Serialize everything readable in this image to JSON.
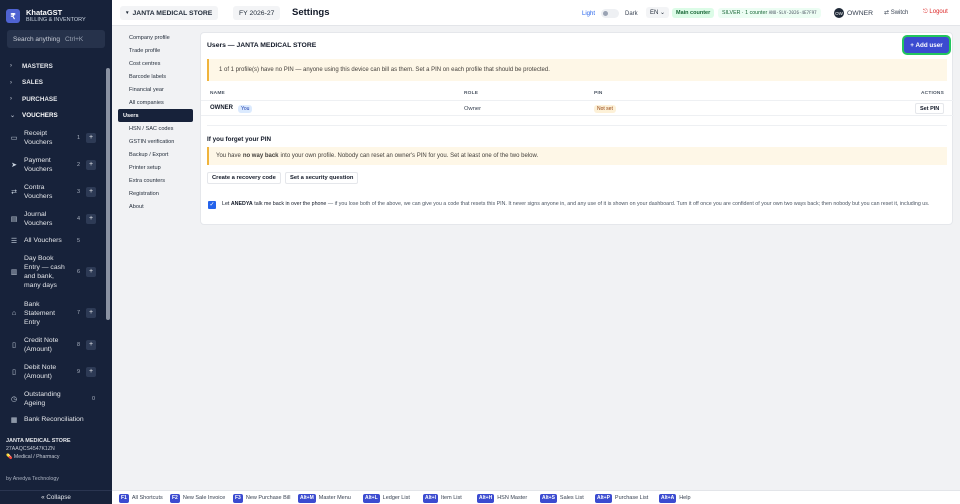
{
  "brand": {
    "name": "KhataGST",
    "subtitle": "BILLING & INVENTORY",
    "logo": "₹"
  },
  "sidebar": {
    "search_placeholder": "Search anything",
    "search_kbd": "Ctrl+K",
    "groups": [
      {
        "label": "MASTERS"
      },
      {
        "label": "SALES"
      },
      {
        "label": "PURCHASE"
      },
      {
        "label": "VOUCHERS"
      }
    ],
    "vouchers": [
      {
        "label": "Receipt Vouchers",
        "num": "1",
        "icon": "receipt-icon"
      },
      {
        "label": "Payment Vouchers",
        "num": "2",
        "icon": "payment-icon"
      },
      {
        "label": "Contra Vouchers",
        "num": "3",
        "icon": "contra-icon"
      },
      {
        "label": "Journal Vouchers",
        "num": "4",
        "icon": "journal-icon"
      },
      {
        "label": "All Vouchers",
        "num": "5",
        "icon": "list-icon"
      },
      {
        "label": "Day Book Entry — cash and bank, many days",
        "num": "6",
        "icon": "book-icon"
      },
      {
        "label": "Bank Statement Entry",
        "num": "7",
        "icon": "bank-icon"
      },
      {
        "label": "Credit Note (Amount)",
        "num": "8",
        "icon": "credit-note-icon"
      },
      {
        "label": "Debit Note (Amount)",
        "num": "9",
        "icon": "debit-note-icon"
      },
      {
        "label": "Outstanding Ageing",
        "num": "0",
        "icon": "clock-icon"
      },
      {
        "label": "Bank Reconciliation",
        "num": "",
        "icon": "reconcile-icon"
      }
    ],
    "store_name": "JANTA MEDICAL STORE",
    "store_gstin": "27AAQCS4547K1ZN",
    "store_type": "💊 Medical / Pharmacy",
    "by": "by Anedya Technology",
    "collapse": "« Collapse"
  },
  "topbar": {
    "store": "JANTA MEDICAL STORE",
    "fy": "FY 2026-27",
    "title": "Settings",
    "light": "Light",
    "dark": "Dark",
    "lang": "EN",
    "counter": "Main counter",
    "silver": "SILVER · 1 counter",
    "silver_code": "ANO-SLV-2026-4E7F97",
    "owner_initials": "OW",
    "owner": "OWNER",
    "switch": "⇄ Switch",
    "logout": "⎋ Logout"
  },
  "settings_nav": [
    "Company profile",
    "Trade profile",
    "Cost centres",
    "Barcode labels",
    "Financial year",
    "All companies",
    "Users",
    "HSN / SAC codes",
    "GSTIN verification",
    "Backup / Export",
    "Printer setup",
    "Extra counters",
    "Registration",
    "About"
  ],
  "main": {
    "title": "Users — JANTA MEDICAL STORE",
    "add_user": "+ Add user",
    "warning": "1 of 1 profile(s) have no PIN — anyone using this device can bill as them. Set a PIN on each profile that should be protected.",
    "cols": {
      "name": "NAME",
      "role": "ROLE",
      "pin": "PIN",
      "actions": "ACTIONS"
    },
    "row": {
      "name": "OWNER",
      "you": "You",
      "role": "Owner",
      "pin": "Not set",
      "action": "Set PIN"
    },
    "forgot_title": "If you forget your PIN",
    "info_a": "You have",
    "info_b": "no way back",
    "info_c": "into your own profile. Nobody can reset an owner's PIN for you. Set at least one of the two below.",
    "btn_recovery": "Create a recovery code",
    "btn_security": "Set a security question",
    "consent_a": "Let",
    "consent_b": "ANEDYA",
    "consent_c": "talk me back in over the phone",
    "consent_d": "— if you lose both of the above, we can give you a code that resets this PIN. It never signs anyone in, and any use of it is shown on your dashboard. Turn it off once you are confident of your own two ways back; then nobody but you can reset it, including us."
  },
  "shortcuts": [
    {
      "key": "F1",
      "label": "All Shortcuts"
    },
    {
      "key": "F2",
      "label": "New Sale Invoice"
    },
    {
      "key": "F3",
      "label": "New Purchase Bill"
    },
    {
      "key": "Alt+M",
      "label": "Master Menu"
    },
    {
      "key": "Alt+L",
      "label": "Ledger List"
    },
    {
      "key": "Alt+I",
      "label": "Item List"
    },
    {
      "key": "Alt+H",
      "label": "HSN Master"
    },
    {
      "key": "Alt+S",
      "label": "Sales List"
    },
    {
      "key": "Alt+P",
      "label": "Purchase List"
    },
    {
      "key": "Alt+A",
      "label": "Help"
    }
  ]
}
